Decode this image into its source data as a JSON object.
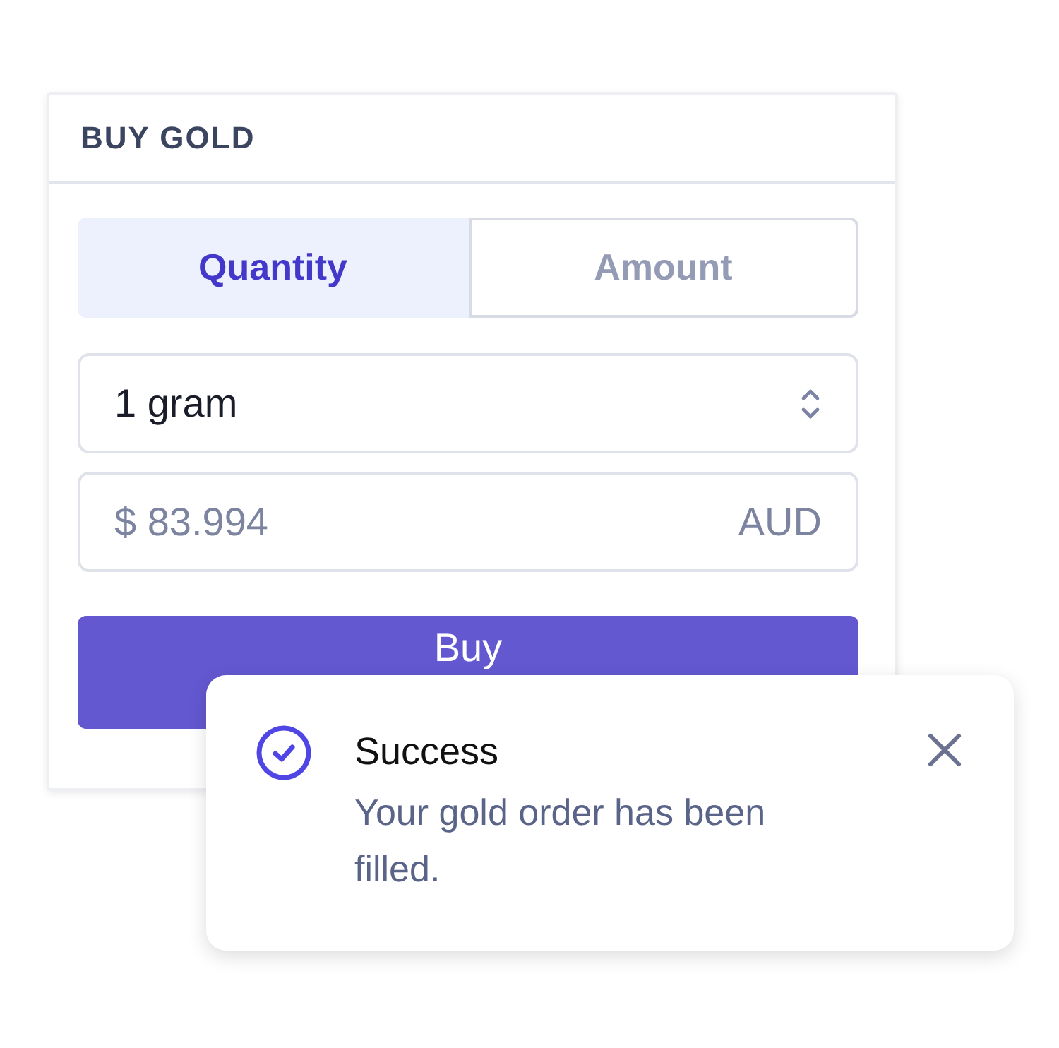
{
  "card": {
    "title": "BUY GOLD"
  },
  "tabs": [
    {
      "label": "Quantity",
      "selected": true
    },
    {
      "label": "Amount",
      "selected": false
    }
  ],
  "quantity_select": {
    "value": "1 gram"
  },
  "price_field": {
    "value": "$ 83.994",
    "currency": "AUD"
  },
  "buy_button": {
    "label": "Buy"
  },
  "toast": {
    "title": "Success",
    "message": "Your gold order has been filled."
  }
}
